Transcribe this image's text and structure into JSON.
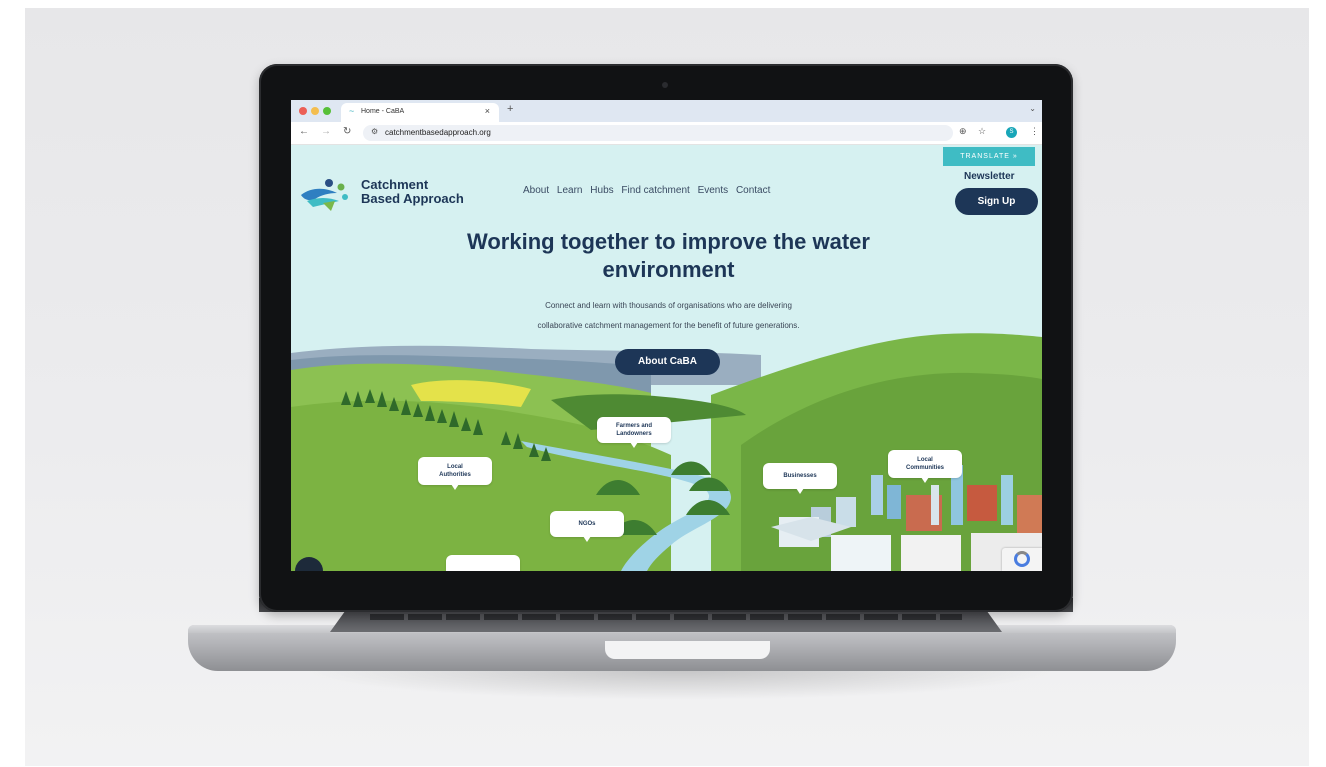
{
  "browser": {
    "tab_title": "Home - CaBA",
    "tab_close": "×",
    "new_tab": "+",
    "url": "catchmentbasedapproach.org",
    "profile_initial": "S",
    "icons": [
      "back-arrow-icon",
      "forward-arrow-icon",
      "reload-icon",
      "site-settings-icon",
      "zoom-icon",
      "bookmark-star-icon",
      "menu-dots-icon",
      "tab-menu-icon"
    ]
  },
  "site": {
    "translate_label": "TRANSLATE »",
    "newsletter_label": "Newsletter",
    "signup_label": "Sign Up",
    "logo_line1": "Catchment",
    "logo_line2": "Based Approach",
    "nav": [
      "About",
      "Learn",
      "Hubs",
      "Find catchment",
      "Events",
      "Contact"
    ]
  },
  "hero": {
    "title_line1": "Working together to improve the water",
    "title_line2": "environment",
    "subtitle_line1": "Connect and learn with thousands of organisations who are delivering",
    "subtitle_line2": "collaborative catchment management for the benefit of future generations.",
    "cta_label": "About CaBA"
  },
  "bubbles": {
    "farmers": "Farmers and\nLandowners",
    "local_authorities": "Local\nAuthorities",
    "ngos": "NGOs",
    "businesses": "Businesses",
    "local_communities": "Local\nCommunities"
  },
  "colors": {
    "brand_navy": "#1d3657",
    "accent_teal": "#3fbcc4",
    "sky": "#d6f1f1",
    "grass": "#7cb342",
    "river": "#9fd3e6"
  }
}
